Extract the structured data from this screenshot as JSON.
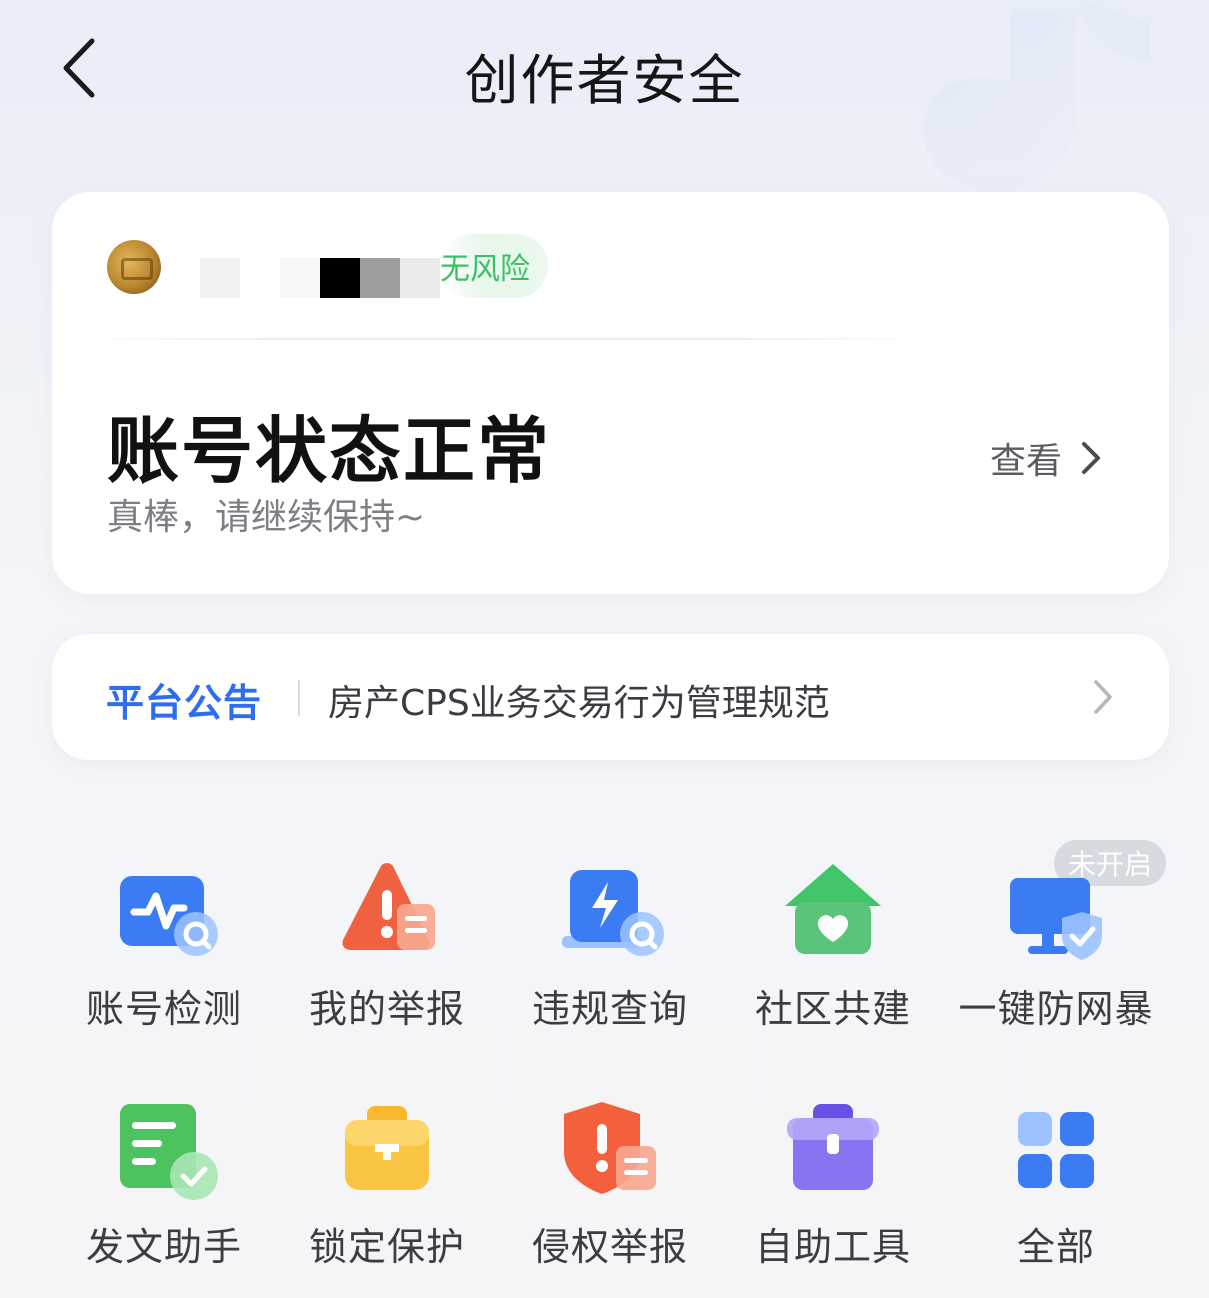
{
  "header": {
    "title": "创作者安全"
  },
  "status_card": {
    "risk_badge": "无风险",
    "status_title": "账号状态正常",
    "status_subtitle": "真棒，请继续保持~",
    "view_label": "查看"
  },
  "notice": {
    "tag": "平台公告",
    "text": "房产CPS业务交易行为管理规范"
  },
  "tools": [
    {
      "label": "账号检测",
      "icon": "account-check-icon"
    },
    {
      "label": "我的举报",
      "icon": "my-report-icon"
    },
    {
      "label": "违规查询",
      "icon": "violation-query-icon"
    },
    {
      "label": "社区共建",
      "icon": "community-icon"
    },
    {
      "label": "一键防网暴",
      "icon": "anti-cyberbullying-icon",
      "badge": "未开启"
    },
    {
      "label": "发文助手",
      "icon": "post-assistant-icon"
    },
    {
      "label": "锁定保护",
      "icon": "lock-protect-icon"
    },
    {
      "label": "侵权举报",
      "icon": "infringement-report-icon"
    },
    {
      "label": "自助工具",
      "icon": "self-service-tools-icon"
    },
    {
      "label": "全部",
      "icon": "all-apps-icon"
    }
  ],
  "colors": {
    "accent_blue": "#2e6cf0",
    "risk_green": "#3cbf66"
  }
}
